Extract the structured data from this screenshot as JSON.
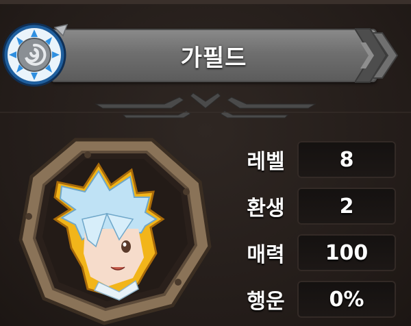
{
  "guild": {
    "name": "가필드"
  },
  "stats": [
    {
      "label": "레벨",
      "value": "8"
    },
    {
      "label": "환생",
      "value": "2"
    },
    {
      "label": "매력",
      "value": "100"
    },
    {
      "label": "행운",
      "value": "0%"
    }
  ],
  "colors": {
    "banner": "#6f6f6f",
    "emblem_blue": "#2f8fe0",
    "frame_wood": "#8a7358",
    "portrait_outline": "#f2b51a",
    "hair": "#bfe2f5"
  },
  "icons": [
    "guild-emblem-icon",
    "banner-arrows-icon",
    "ornament-divider",
    "character-portrait"
  ]
}
